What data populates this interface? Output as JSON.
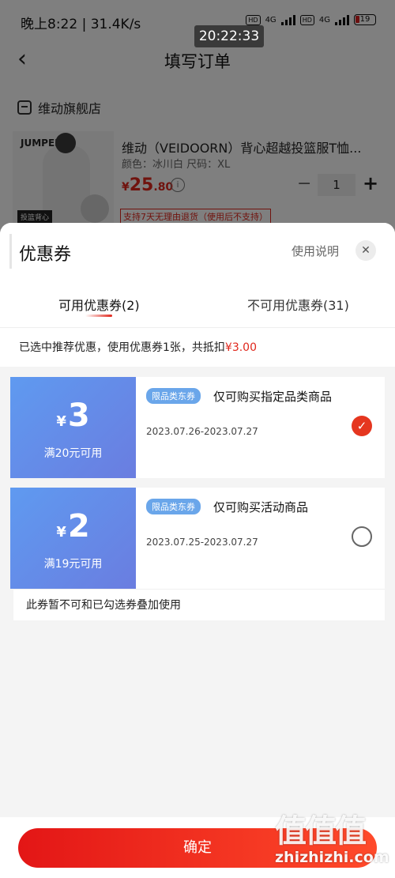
{
  "status_bar": {
    "left": "晚上8:22 | 31.4K/s",
    "overlay_time": "20:22:33",
    "network_1": "4G",
    "network_2": "4G",
    "hd_1": "HD",
    "hd_2": "HD",
    "battery": "19"
  },
  "nav": {
    "back_icon": "chevron-left-icon",
    "title": "填写订单"
  },
  "store": {
    "icon": "store-icon",
    "name": "维动旗舰店"
  },
  "product": {
    "image_brand": "JUMPER",
    "image_tag": "投篮背心",
    "title": "维动（VEIDOORN）背心超越投篮服T恤...",
    "spec": "颜色：冰川白   尺码：XL",
    "price_symbol": "¥",
    "price_int": "25",
    "price_dec": ".80",
    "quantity": "1",
    "minus": "−",
    "plus": "+",
    "return_policy": "支持7天无理由退货（使用后不支持）"
  },
  "sheet": {
    "title": "优惠券",
    "usage_link": "使用说明",
    "close": "✕",
    "tabs": [
      {
        "label": "可用优惠券(2)",
        "active": true
      },
      {
        "label": "不可用优惠券(31)",
        "active": false
      }
    ],
    "summary_prefix": "已选中推荐优惠，使用优惠券1张，共抵扣",
    "summary_amount": "¥3.00"
  },
  "coupons": [
    {
      "currency": "¥",
      "amount": "3",
      "condition": "满20元可用",
      "badge": "限品类东券",
      "description": "仅可购买指定品类商品",
      "date_range": "2023.07.26-2023.07.27",
      "selected": true
    },
    {
      "currency": "¥",
      "amount": "2",
      "condition": "满19元可用",
      "badge": "限品类东券",
      "description": "仅可购买活动商品",
      "date_range": "2023.07.25-2023.07.27",
      "selected": false
    }
  ],
  "coupon_note": "此券暂不可和已勾选券叠加使用",
  "confirm_button": "确定",
  "watermark": {
    "glyphs": "值值值",
    "url": "zhizhizhi.com"
  },
  "colors": {
    "accent_red": "#e0271c",
    "coupon_blue": "#6a8fe8"
  }
}
